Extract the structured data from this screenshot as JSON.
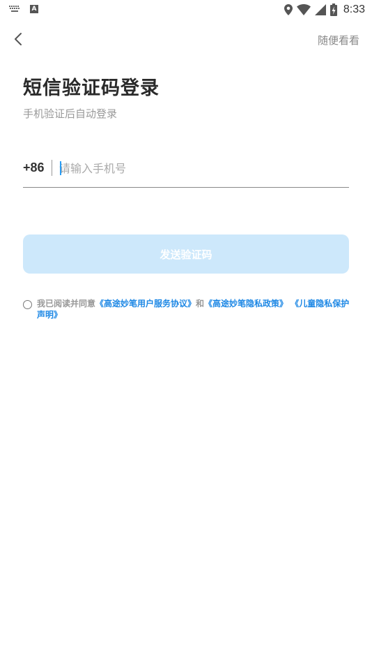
{
  "status_bar": {
    "time": "8:33",
    "left_icons": [
      "keyboard-icon",
      "a-notification-icon"
    ],
    "right_icons": [
      "location-icon",
      "wifi-icon",
      "signal-icon",
      "battery-charging-icon"
    ]
  },
  "header": {
    "back_icon": "chevron-left-icon",
    "skip_label": "随便看看"
  },
  "main": {
    "title": "短信验证码登录",
    "subtitle": "手机验证后自动登录",
    "country_code": "+86",
    "phone_placeholder": "请输入手机号",
    "phone_value": "",
    "send_button_label": "发送验证码"
  },
  "agreement": {
    "checked": false,
    "prefix": "我已阅读并同意",
    "link_user_agreement": "《高途妙笔用户服务协议》",
    "conjunction": "和",
    "link_privacy_policy": "《高途妙笔隐私政策》",
    "link_child_privacy": "《儿童隐私保护声明》"
  },
  "colors": {
    "accent": "#1e88e5",
    "button_disabled_bg": "#cde8fb",
    "caret": "#2a9df4"
  }
}
